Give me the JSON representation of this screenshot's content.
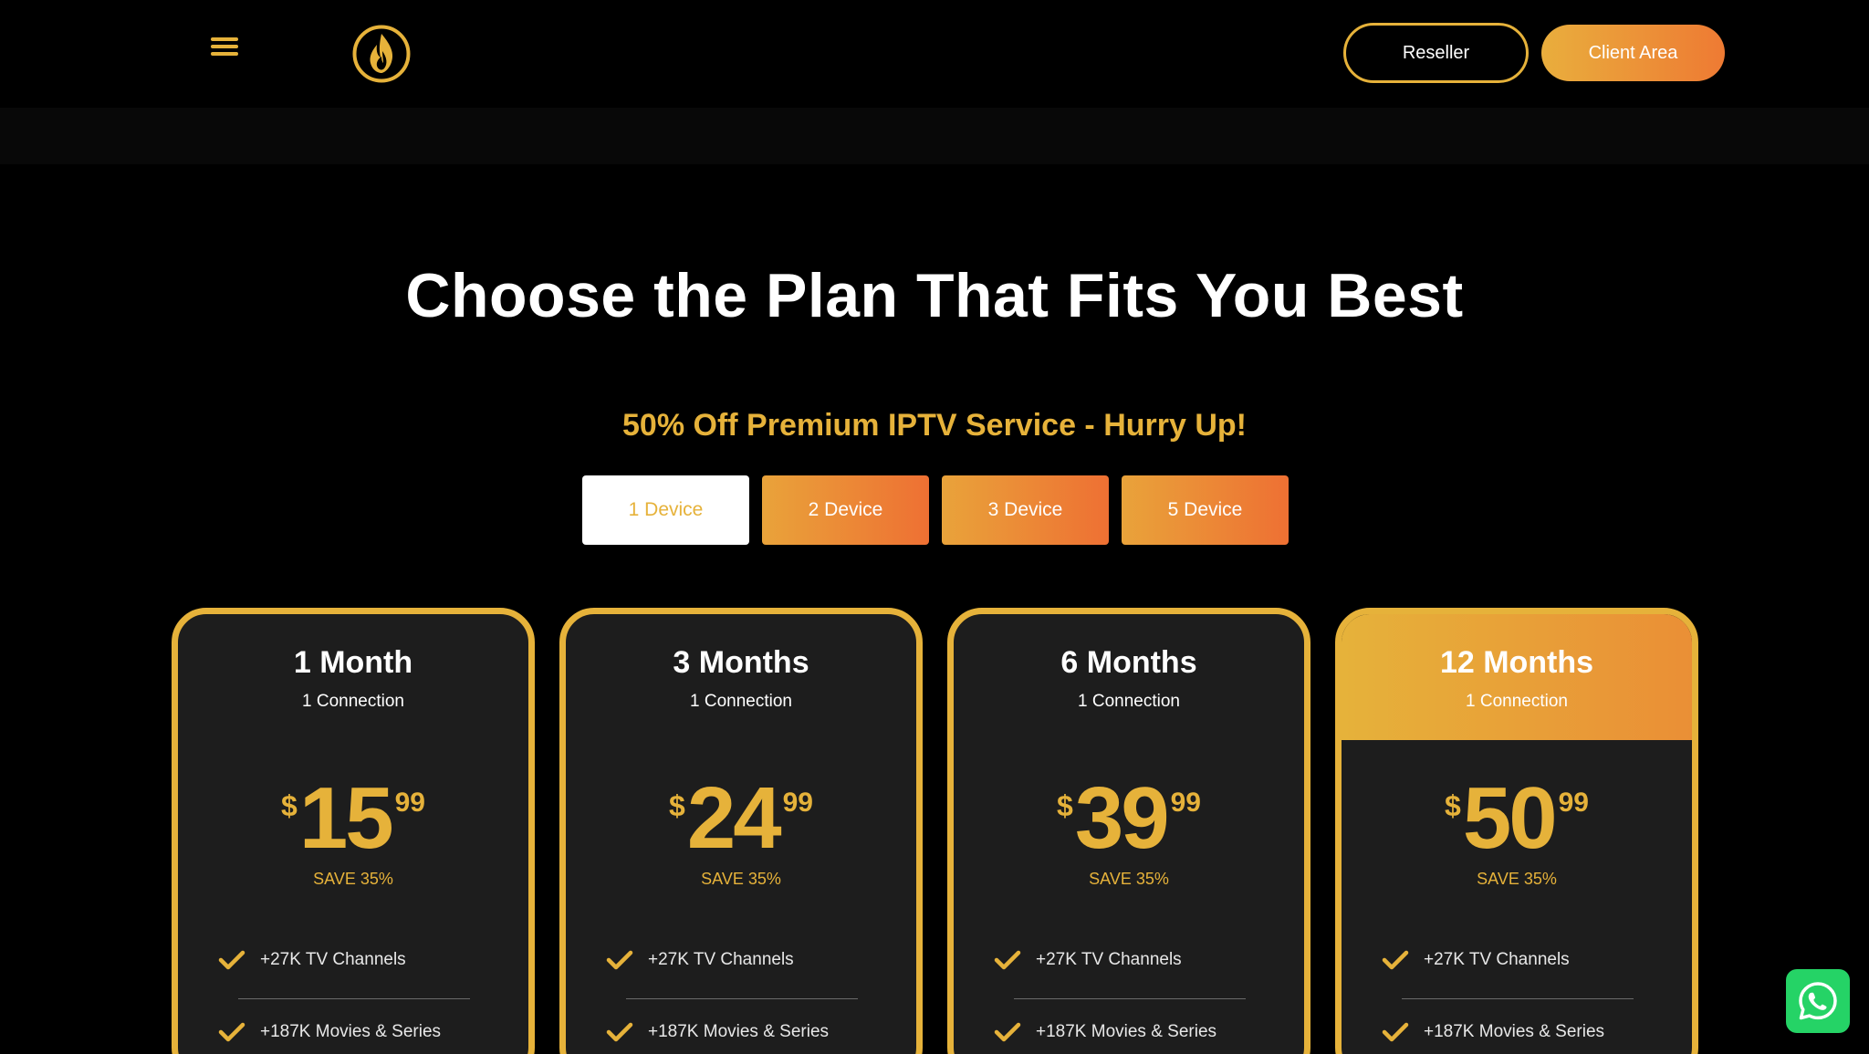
{
  "header": {
    "reseller_label": "Reseller",
    "client_area_label": "Client Area"
  },
  "colors": {
    "accent": "#e6b23a",
    "gradient_end": "#ee7a33",
    "card_bg": "#1d1d1d",
    "whatsapp": "#25d366"
  },
  "hero": {
    "title": "Choose the Plan That Fits You Best",
    "subtitle": "50% Off Premium IPTV Service - Hurry Up!"
  },
  "device_tabs": [
    {
      "label": "1 Device",
      "active": true
    },
    {
      "label": "2 Device",
      "active": false
    },
    {
      "label": "3 Device",
      "active": false
    },
    {
      "label": "5 Device",
      "active": false
    }
  ],
  "plans": [
    {
      "period": "1 Month",
      "connection": "1 Connection",
      "currency": "$",
      "price_main": "15",
      "price_cents": "99",
      "save": "SAVE 35%",
      "features": [
        "+27K TV Channels",
        "+187K Movies & Series"
      ]
    },
    {
      "period": "3 Months",
      "connection": "1 Connection",
      "currency": "$",
      "price_main": "24",
      "price_cents": "99",
      "save": "SAVE 35%",
      "features": [
        "+27K TV Channels",
        "+187K Movies & Series"
      ]
    },
    {
      "period": "6 Months",
      "connection": "1 Connection",
      "currency": "$",
      "price_main": "39",
      "price_cents": "99",
      "save": "SAVE 35%",
      "features": [
        "+27K TV Channels",
        "+187K Movies & Series"
      ]
    },
    {
      "period": "12 Months",
      "connection": "1 Connection",
      "currency": "$",
      "price_main": "50",
      "price_cents": "99",
      "save": "SAVE 35%",
      "features": [
        "+27K TV Channels",
        "+187K Movies & Series"
      ],
      "featured": true
    }
  ],
  "icons": {
    "menu": "hamburger-icon",
    "logo": "flame-logo-icon",
    "check": "check-icon",
    "whatsapp": "whatsapp-icon"
  }
}
